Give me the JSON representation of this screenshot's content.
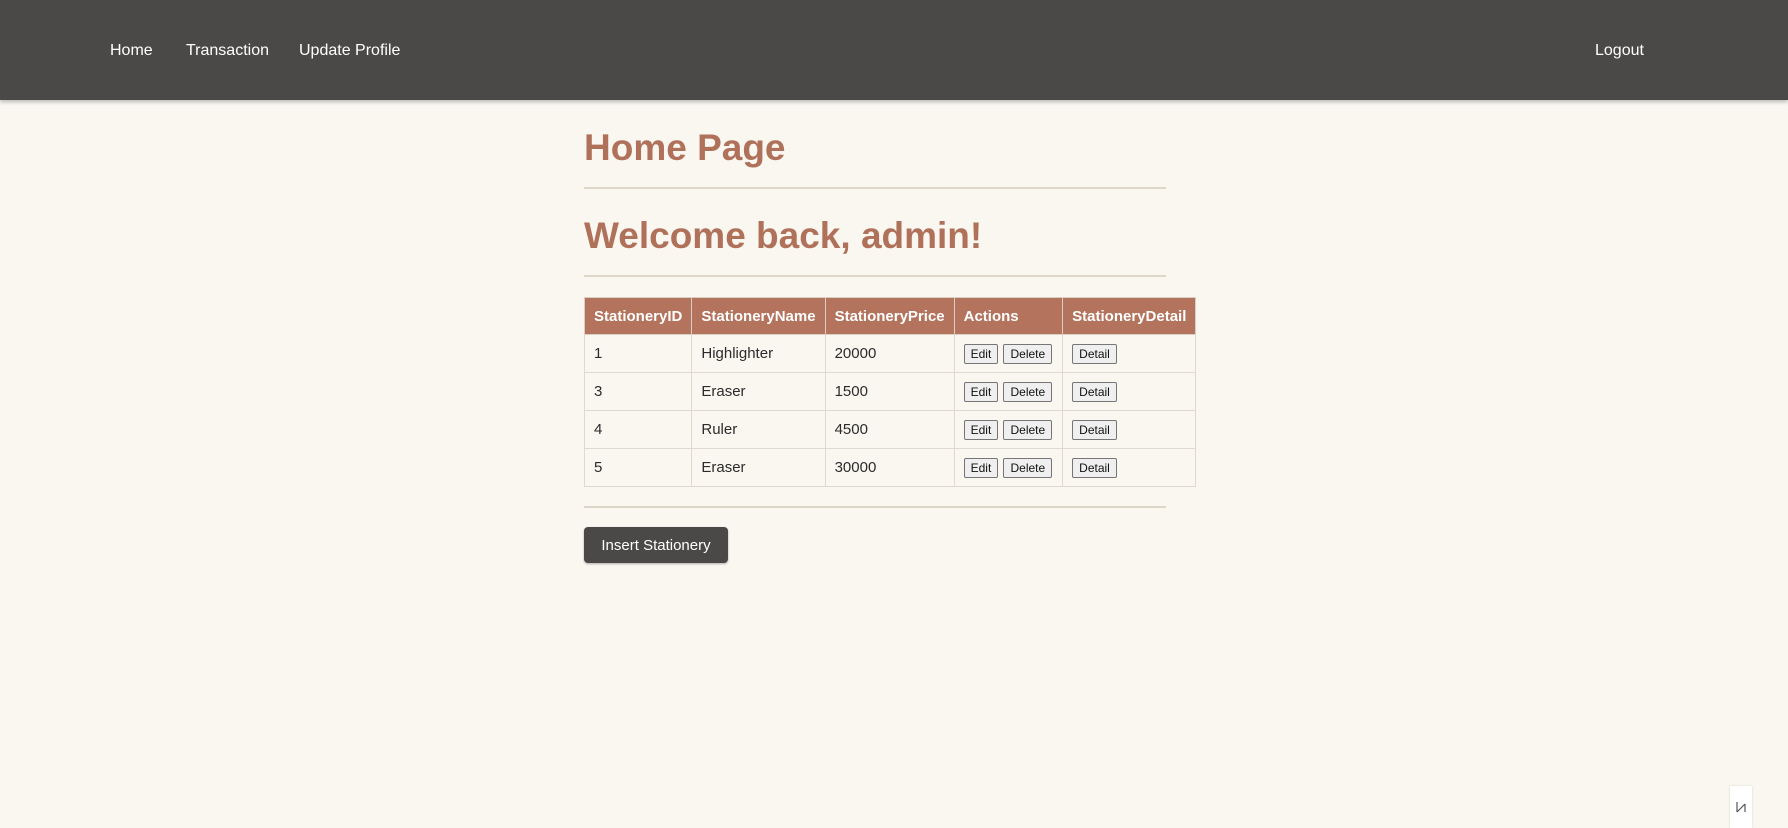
{
  "nav": {
    "home": "Home",
    "transaction": "Transaction",
    "update_profile": "Update Profile",
    "logout": "Logout"
  },
  "page": {
    "title": "Home Page",
    "welcome": "Welcome back, admin!"
  },
  "table": {
    "headers": [
      "StationeryID",
      "StationeryName",
      "StationeryPrice",
      "Actions",
      "StationeryDetail"
    ],
    "rows": [
      {
        "id": "1",
        "name": "Highlighter",
        "price": "20000"
      },
      {
        "id": "3",
        "name": "Eraser",
        "price": "1500"
      },
      {
        "id": "4",
        "name": "Ruler",
        "price": "4500"
      },
      {
        "id": "5",
        "name": "Eraser",
        "price": "30000"
      }
    ],
    "edit_label": "Edit",
    "delete_label": "Delete",
    "detail_label": "Detail"
  },
  "insert_button": "Insert Stationery",
  "corner_icon": "resize-icon",
  "colors": {
    "navbar": "#4a4947",
    "accent": "#b0715a",
    "table_header": "#b3735c",
    "background": "#faf7f1"
  }
}
